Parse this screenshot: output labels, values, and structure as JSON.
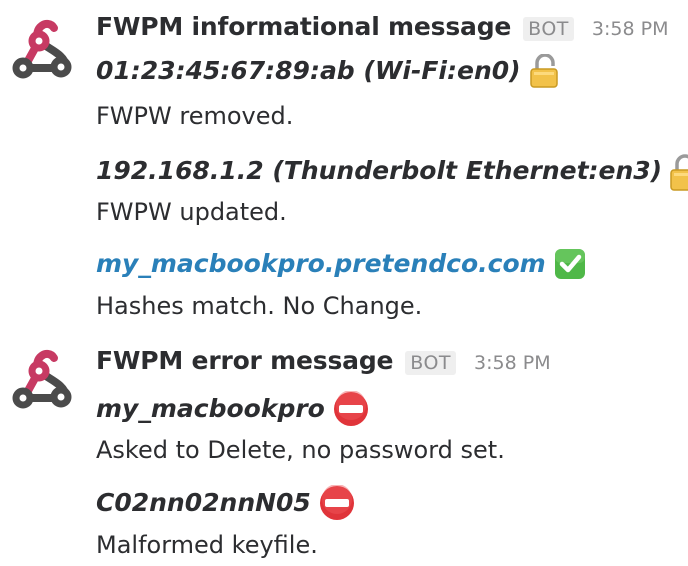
{
  "messages": [
    {
      "sender": "FWPM informational message",
      "badge": "BOT",
      "time": "3:58 PM",
      "avatar_icon": "webhook-icon",
      "items": [
        {
          "title": "01:23:45:67:89:ab (Wi-Fi:en0)",
          "icon": "unlocked-padlock-icon",
          "body": "FWPW removed."
        },
        {
          "title": "192.168.1.2 (Thunderbolt Ethernet:en3)",
          "icon": "locked-padlock-with-key-icon",
          "body": "FWPW updated."
        },
        {
          "title": "my_macbookpro.pretendco.com",
          "icon": "check-mark-button-icon",
          "body": "Hashes match. No Change.",
          "is_link": true
        }
      ]
    },
    {
      "sender": "FWPM error message",
      "badge": "BOT",
      "time": "3:58 PM",
      "avatar_icon": "webhook-icon",
      "items": [
        {
          "title": "my_macbookpro",
          "icon": "no-entry-icon",
          "body": "Asked to Delete, no password set."
        },
        {
          "title": "C02nn02nnN05",
          "icon": "no-entry-icon",
          "body": "Malformed keyfile."
        }
      ]
    }
  ],
  "colors": {
    "text": "#2c2d30",
    "muted": "#8b8b8d",
    "link": "#2a80b9",
    "avatar_red": "#c73a63",
    "avatar_dark": "#4b4b4b",
    "check_green": "#4fb848",
    "no_entry_red": "#e0343a"
  }
}
